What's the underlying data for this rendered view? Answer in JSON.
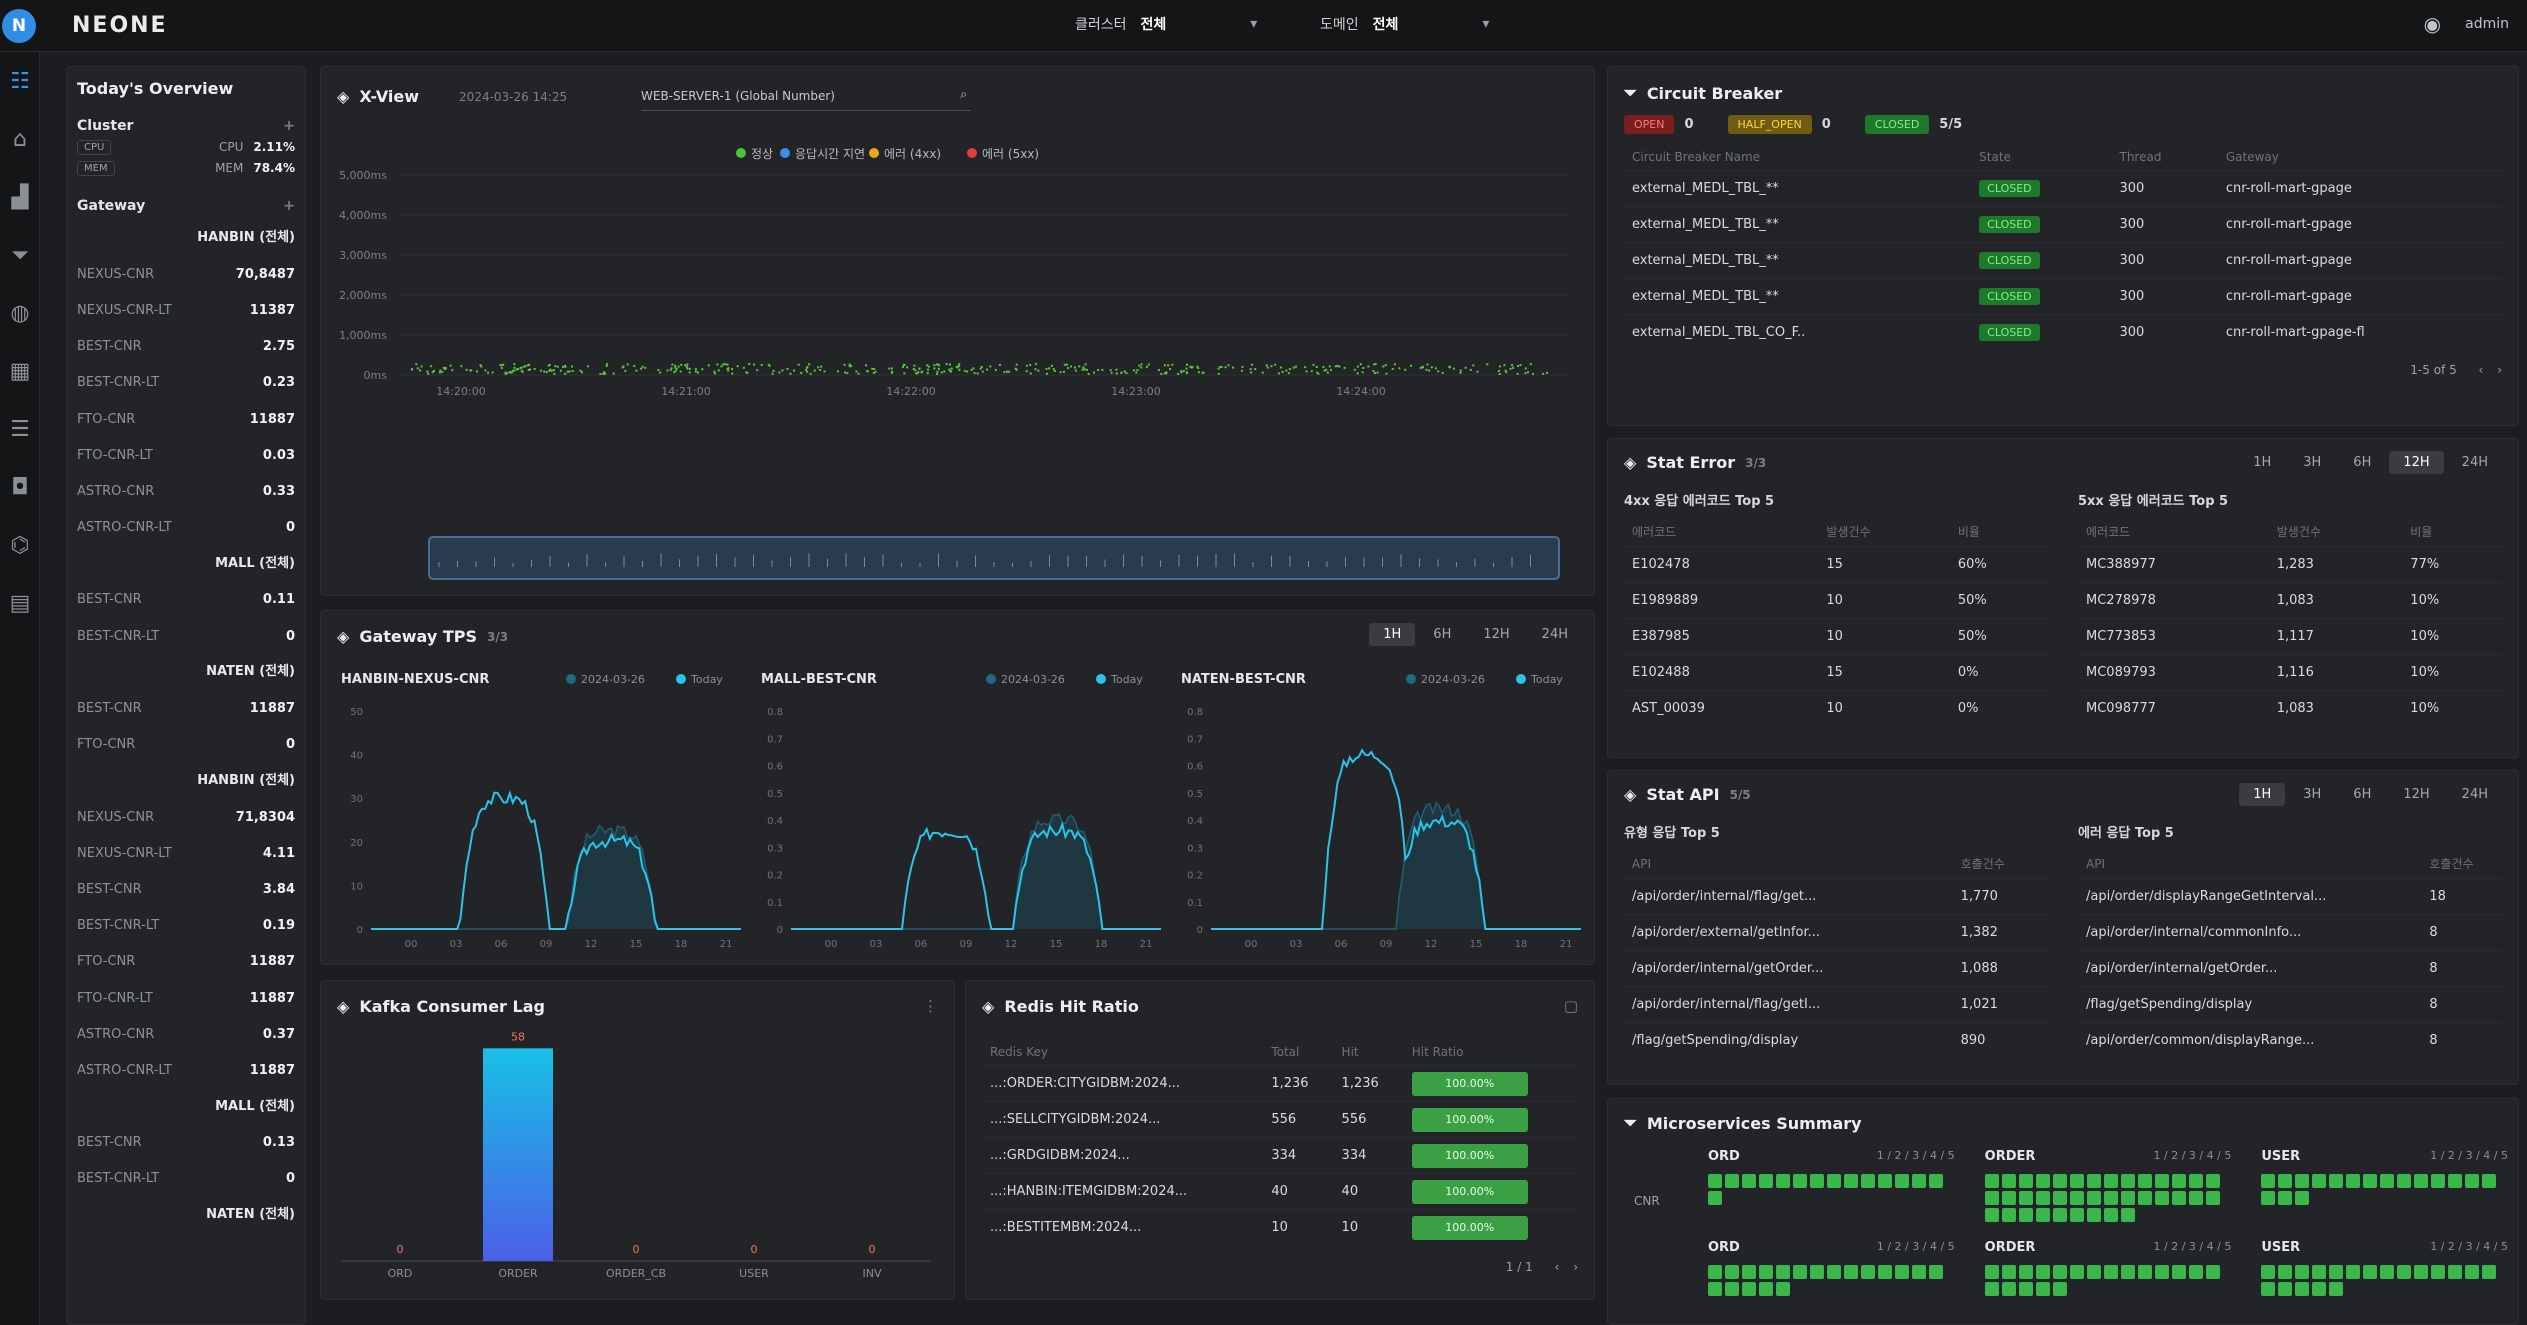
{
  "brand": "NEONE",
  "top": {
    "sel1_label": "클러스터",
    "sel1_value": "전체",
    "sel2_label": "도메인",
    "sel2_value": "전체",
    "user": "admin"
  },
  "sidebar": [
    "dashboard-icon",
    "home-icon",
    "chart-icon",
    "filter-icon",
    "server-icon",
    "database-icon",
    "list-icon",
    "lock-icon",
    "gateway-icon",
    "calendar-icon"
  ],
  "overview": {
    "title": "Today's Overview",
    "cluster_label": "Cluster",
    "cluster_rows": [
      {
        "tag": "CPU",
        "k": "CPU",
        "v": "2.11%"
      },
      {
        "tag": "MEM",
        "k": "MEM",
        "v": "78.4%"
      }
    ],
    "gateway_label": "Gateway",
    "groups": [
      {
        "name": "HANBIN (전체)",
        "rows": [
          [
            "NEXUS-CNR",
            "70,8487"
          ],
          [
            "NEXUS-CNR-LT",
            "11387"
          ],
          [
            "BEST-CNR",
            "2.75"
          ],
          [
            "BEST-CNR-LT",
            "0.23"
          ],
          [
            "FTO-CNR",
            "11887"
          ],
          [
            "FTO-CNR-LT",
            "0.03"
          ],
          [
            "ASTRO-CNR",
            "0.33"
          ],
          [
            "ASTRO-CNR-LT",
            "0"
          ]
        ]
      },
      {
        "name": "MALL (전체)",
        "rows": [
          [
            "BEST-CNR",
            "0.11"
          ],
          [
            "BEST-CNR-LT",
            "0"
          ]
        ]
      },
      {
        "name": "NATEN (전체)",
        "rows": [
          [
            "BEST-CNR",
            "11887"
          ],
          [
            "FTO-CNR",
            "0"
          ]
        ]
      },
      {
        "name": "HANBIN (전체)",
        "rows": [
          [
            "NEXUS-CNR",
            "71,8304"
          ],
          [
            "NEXUS-CNR-LT",
            "4.11"
          ],
          [
            "BEST-CNR",
            "3.84"
          ],
          [
            "BEST-CNR-LT",
            "0.19"
          ],
          [
            "FTO-CNR",
            "11887"
          ],
          [
            "FTO-CNR-LT",
            "11887"
          ],
          [
            "ASTRO-CNR",
            "0.37"
          ],
          [
            "ASTRO-CNR-LT",
            "11887"
          ]
        ]
      },
      {
        "name": "MALL (전체)",
        "rows": [
          [
            "BEST-CNR",
            "0.13"
          ],
          [
            "BEST-CNR-LT",
            "0"
          ]
        ]
      },
      {
        "name": "NATEN (전체)",
        "rows": []
      }
    ]
  },
  "xview": {
    "title": "X-View",
    "time": "2024-03-26 14:25",
    "search": "WEB-SERVER-1 (Global Number)",
    "legend": [
      "정상",
      "응답시간 지연",
      "에러 (4xx)",
      "에러 (5xx)"
    ],
    "legend_colors": [
      "#48c13e",
      "#3d8fe8",
      "#e6a817",
      "#e23b3b"
    ],
    "yticks": [
      "5,000ms",
      "4,000ms",
      "3,000ms",
      "2,000ms",
      "1,000ms",
      "0ms"
    ],
    "xticks": [
      "14:20:00",
      "14:21:00",
      "14:22:00",
      "14:23:00",
      "14:24:00"
    ]
  },
  "tps": {
    "title": "Gateway TPS",
    "count": "3/3",
    "tabs": [
      "1H",
      "6H",
      "12H",
      "24H"
    ],
    "charts": [
      {
        "name": "HANBIN-NEXUS-CNR",
        "legend": [
          "2024-03-26",
          "Today"
        ],
        "yticks": [
          "50",
          "40",
          "30",
          "20",
          "10",
          "0"
        ]
      },
      {
        "name": "MALL-BEST-CNR",
        "legend": [
          "2024-03-26",
          "Today"
        ],
        "yticks": [
          "0.8",
          "0.7",
          "0.6",
          "0.5",
          "0.4",
          "0.3",
          "0.2",
          "0.1",
          "0"
        ]
      },
      {
        "name": "NATEN-BEST-CNR",
        "legend": [
          "2024-03-26",
          "Today"
        ],
        "yticks": [
          "0.8",
          "0.7",
          "0.6",
          "0.5",
          "0.4",
          "0.3",
          "0.2",
          "0.1",
          "0"
        ]
      }
    ],
    "xticks": [
      "00",
      "03",
      "06",
      "09",
      "12",
      "15",
      "18",
      "21"
    ]
  },
  "kafka": {
    "title": "Kafka Consumer Lag",
    "categories": [
      "ORD",
      "ORDER",
      "ORDER_CB",
      "USER",
      "INV"
    ],
    "values": [
      0,
      58,
      0,
      0,
      0
    ],
    "labels": [
      "0",
      "58",
      "0",
      "0",
      "0"
    ]
  },
  "redis": {
    "title": "Redis Hit Ratio",
    "headers": [
      "Redis Key",
      "Total",
      "Hit",
      "Hit Ratio"
    ],
    "rows": [
      [
        "...:ORDER:CITYGIDBM:2024...",
        "1,236",
        "1,236",
        "100.00%"
      ],
      [
        "...:SELLCITYGIDBM:2024...",
        "556",
        "556",
        "100.00%"
      ],
      [
        "...:GRDGIDBM:2024...",
        "334",
        "334",
        "100.00%"
      ],
      [
        "...:HANBIN:ITEMGIDBM:2024...",
        "40",
        "40",
        "100.00%"
      ],
      [
        "...:BESTITEMBM:2024...",
        "10",
        "10",
        "100.00%"
      ]
    ],
    "pager": "1 / 1"
  },
  "cb": {
    "title": "Circuit Breaker",
    "open_label": "OPEN",
    "open_count": "0",
    "half_label": "HALF_OPEN",
    "half_count": "0",
    "closed_label": "CLOSED",
    "closed_count": "5/5",
    "headers": [
      "Circuit Breaker Name",
      "State",
      "Thread",
      "Gateway"
    ],
    "rows": [
      [
        "external_MEDL_TBL_**",
        "CLOSED",
        "300",
        "cnr-roll-mart-gpage"
      ],
      [
        "external_MEDL_TBL_**",
        "CLOSED",
        "300",
        "cnr-roll-mart-gpage"
      ],
      [
        "external_MEDL_TBL_**",
        "CLOSED",
        "300",
        "cnr-roll-mart-gpage"
      ],
      [
        "external_MEDL_TBL_**",
        "CLOSED",
        "300",
        "cnr-roll-mart-gpage"
      ],
      [
        "external_MEDL_TBL_CO_F..",
        "CLOSED",
        "300",
        "cnr-roll-mart-gpage-fl"
      ]
    ],
    "pager": "1-5 of 5"
  },
  "starerr": {
    "title": "Stat Error",
    "count": "3/3",
    "tabs": [
      "1H",
      "3H",
      "6H",
      "12H",
      "24H"
    ],
    "active_tab": "12H",
    "left": {
      "title": "4xx 응답 에러코드 Top 5",
      "headers": [
        "에러코드",
        "발생건수",
        "비율"
      ],
      "rows": [
        [
          "E102478",
          "15",
          "60%"
        ],
        [
          "E1989889",
          "10",
          "50%"
        ],
        [
          "E387985",
          "10",
          "50%"
        ],
        [
          "E102488",
          "15",
          "0%"
        ],
        [
          "AST_00039",
          "10",
          "0%"
        ]
      ]
    },
    "right": {
      "title": "5xx 응답 에러코드 Top 5",
      "headers": [
        "에러코드",
        "발생건수",
        "비율"
      ],
      "rows": [
        [
          "MC388977",
          "1,283",
          "77%"
        ],
        [
          "MC278978",
          "1,083",
          "10%"
        ],
        [
          "MC773853",
          "1,117",
          "10%"
        ],
        [
          "MC089793",
          "1,116",
          "10%"
        ],
        [
          "MC098777",
          "1,083",
          "10%"
        ]
      ]
    }
  },
  "statapi": {
    "title": "Stat API",
    "count": "5/5",
    "tabs": [
      "1H",
      "3H",
      "6H",
      "12H",
      "24H"
    ],
    "active_tab": "1H",
    "left": {
      "title": "유형 응답 Top 5",
      "headers": [
        "API",
        "호출건수"
      ],
      "rows": [
        [
          "/api/order/internal/flag/get...",
          "1,770"
        ],
        [
          "/api/order/external/getInfor...",
          "1,382"
        ],
        [
          "/api/order/internal/getOrder...",
          "1,088"
        ],
        [
          "/api/order/internal/flag/getI...",
          "1,021"
        ],
        [
          "/flag/getSpending/display",
          "890"
        ]
      ]
    },
    "right": {
      "title": "에러 응답 Top 5",
      "headers": [
        "API",
        "호출건수"
      ],
      "rows": [
        [
          "/api/order/displayRangeGetInterval...",
          "18"
        ],
        [
          "/api/order/internal/commonInfo...",
          "8"
        ],
        [
          "/api/order/internal/getOrder...",
          "8"
        ],
        [
          "/flag/getSpending/display",
          "8"
        ],
        [
          "/api/order/common/displayRange...",
          "8"
        ]
      ]
    }
  },
  "micro": {
    "title": "Microservices Summary",
    "row_label": "CNR",
    "cells": [
      {
        "name": "ORD",
        "status": "1 / 2 / 3 / 4 / 5",
        "dots": 15
      },
      {
        "name": "ORDER",
        "status": "1 / 2 / 3 / 4 / 5",
        "dots": 37
      },
      {
        "name": "USER",
        "status": "1 / 2 / 3 / 4 / 5",
        "dots": 17
      },
      {
        "name": "ORD",
        "status": "1 / 2 / 3 / 4 / 5",
        "dots": 19
      },
      {
        "name": "ORDER",
        "status": "1 / 2 / 3 / 4 / 5",
        "dots": 19
      },
      {
        "name": "USER",
        "status": "1 / 2 / 3 / 4 / 5",
        "dots": 19
      }
    ]
  }
}
